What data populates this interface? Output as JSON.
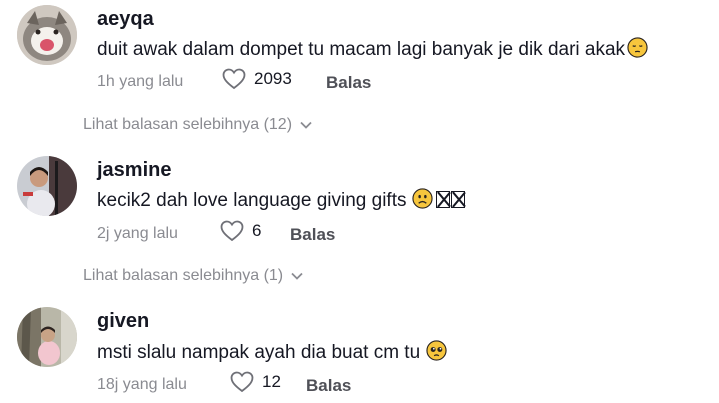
{
  "comments": [
    {
      "username": "aeyqa",
      "text": "duit awak dalam dompet tu macam lagi banyak je dik dari akak",
      "emoji": "pensive-face-emoji",
      "time": "1h yang lalu",
      "likes": "2093",
      "reply_label": "Balas",
      "more_replies": "Lihat balasan selebihnya (12)"
    },
    {
      "username": "jasmine",
      "text": "kecik2 dah love language giving gifts",
      "emoji": "slightly-frowning-face-emoji",
      "time": "2j yang lalu",
      "likes": "6",
      "reply_label": "Balas",
      "more_replies": "Lihat balasan selebihnya (1)"
    },
    {
      "username": "given",
      "text": "msti slalu nampak ayah dia buat cm tu",
      "emoji": "pleading-face-emoji",
      "time": "18j yang lalu",
      "likes": "12",
      "reply_label": "Balas"
    }
  ],
  "colors": {
    "primary_text": "#161823",
    "secondary_text": "#8a8b91",
    "reply_text": "#4f5057",
    "emoji_yellow": "#f7c63d"
  }
}
